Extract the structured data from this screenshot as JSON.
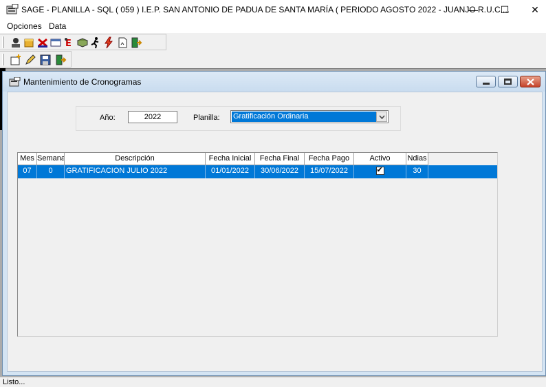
{
  "window": {
    "title": "SAGE - PLANILLA - SQL  ( 059 ) I.E.P. SAN ANTONIO DE PADUA DE SANTA MARÍA ( PERIODO AGOSTO 2022 - JUANJO  R.U.C....",
    "minimize": "—",
    "maximize": "☐",
    "close": "✕"
  },
  "menu": {
    "opciones": "Opciones",
    "data": "Data"
  },
  "child_window": {
    "title": "Mantenimiento de Cronogramas"
  },
  "filters": {
    "year_label": "Año:",
    "year_value": "2022",
    "planilla_label": "Planilla:",
    "planilla_value": "Gratificación Ordinaria"
  },
  "grid": {
    "columns": [
      "Mes",
      "Semana",
      "Descripción",
      "Fecha Inicial",
      "Fecha Final",
      "Fecha Pago",
      "Activo",
      "Ndias"
    ],
    "rows": [
      {
        "mes": "07",
        "semana": "0",
        "descripcion": "GRATIFICACION JULIO 2022",
        "fecha_inicial": "01/01/2022",
        "fecha_final": "30/06/2022",
        "fecha_pago": "15/07/2022",
        "activo": true,
        "ndias": "30"
      }
    ]
  },
  "status": {
    "text": "Listo..."
  },
  "colors": {
    "selection": "#0078d7",
    "mdi_background": "#ababab",
    "child_frame": "#d4e4f3"
  }
}
